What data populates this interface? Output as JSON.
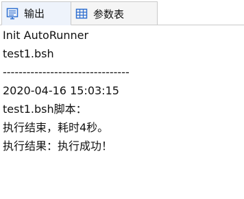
{
  "tabs": [
    {
      "label": "输出",
      "icon": "output-window-icon",
      "active": true
    },
    {
      "label": "参数表",
      "icon": "table-grid-icon",
      "active": false
    }
  ],
  "output": {
    "lines": [
      "Init AutoRunner",
      "test1.bsh",
      "--------------------------------",
      "2020-04-16 15:03:15",
      "test1.bsh脚本：",
      "执行结束，耗时4秒。",
      "执行结果：执行成功！"
    ]
  },
  "colors": {
    "icon_blue": "#2f6fd0",
    "active_tab_bg": "#eef3fb",
    "tab_border": "#c9c9c9"
  }
}
